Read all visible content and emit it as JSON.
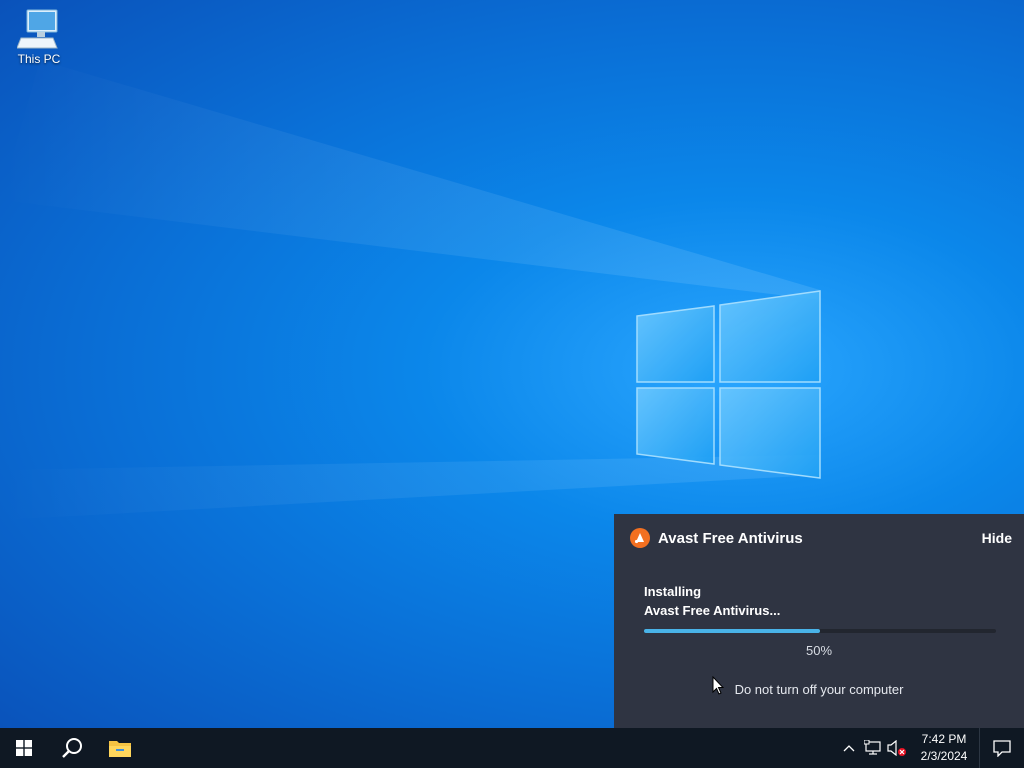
{
  "desktop": {
    "icons": [
      {
        "label": "This PC",
        "icon": "computer-icon"
      }
    ]
  },
  "avast": {
    "title": "Avast Free Antivirus",
    "hide_label": "Hide",
    "status_line1": "Installing",
    "status_line2": "Avast Free Antivirus...",
    "progress": 50,
    "progress_label": "50%",
    "note": "Do not turn off your computer",
    "accent": "#f37021",
    "progress_color": "#49b3e8"
  },
  "taskbar": {
    "start_icon": "windows-start-icon",
    "search_icon": "search-icon",
    "pinned": [
      {
        "name": "file-explorer",
        "icon": "folder-icon"
      }
    ],
    "tray": {
      "icons": [
        "chevron-up-icon",
        "network-icon",
        "volume-muted-icon"
      ],
      "time": "7:42 PM",
      "date": "2/3/2024"
    }
  }
}
